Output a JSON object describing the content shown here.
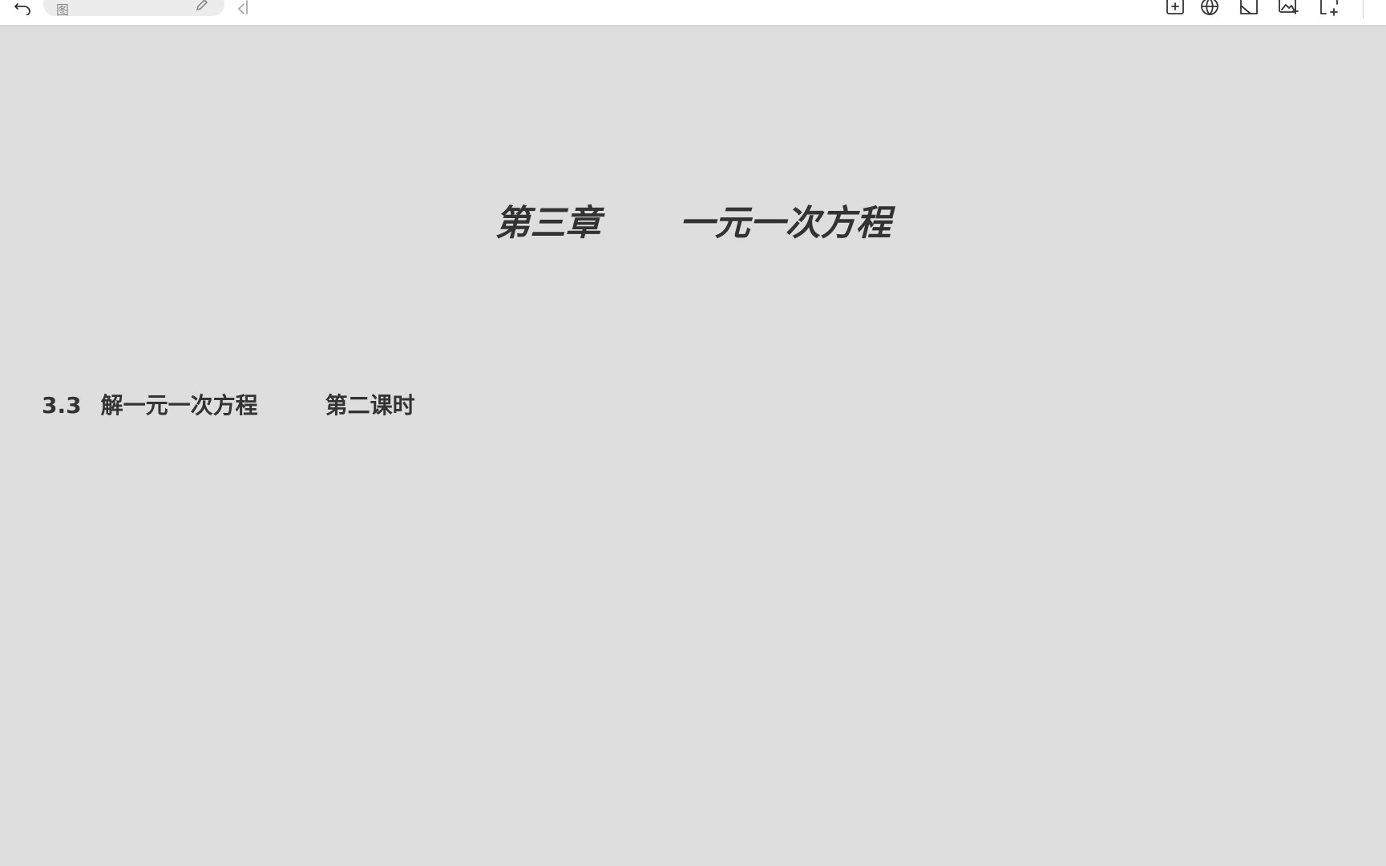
{
  "toolbar": {
    "search_text": "图",
    "icons": [
      "undo-icon",
      "edit-icon",
      "back-icon",
      "insert-table-icon",
      "globe-icon",
      "shape-icon",
      "insert-image-icon",
      "insert-frame-icon"
    ]
  },
  "slide": {
    "chapter_label": "第三章",
    "chapter_name": "一元一次方程",
    "section_number": "3.3",
    "section_name": "解一元一次方程",
    "lesson": "第二课时"
  }
}
